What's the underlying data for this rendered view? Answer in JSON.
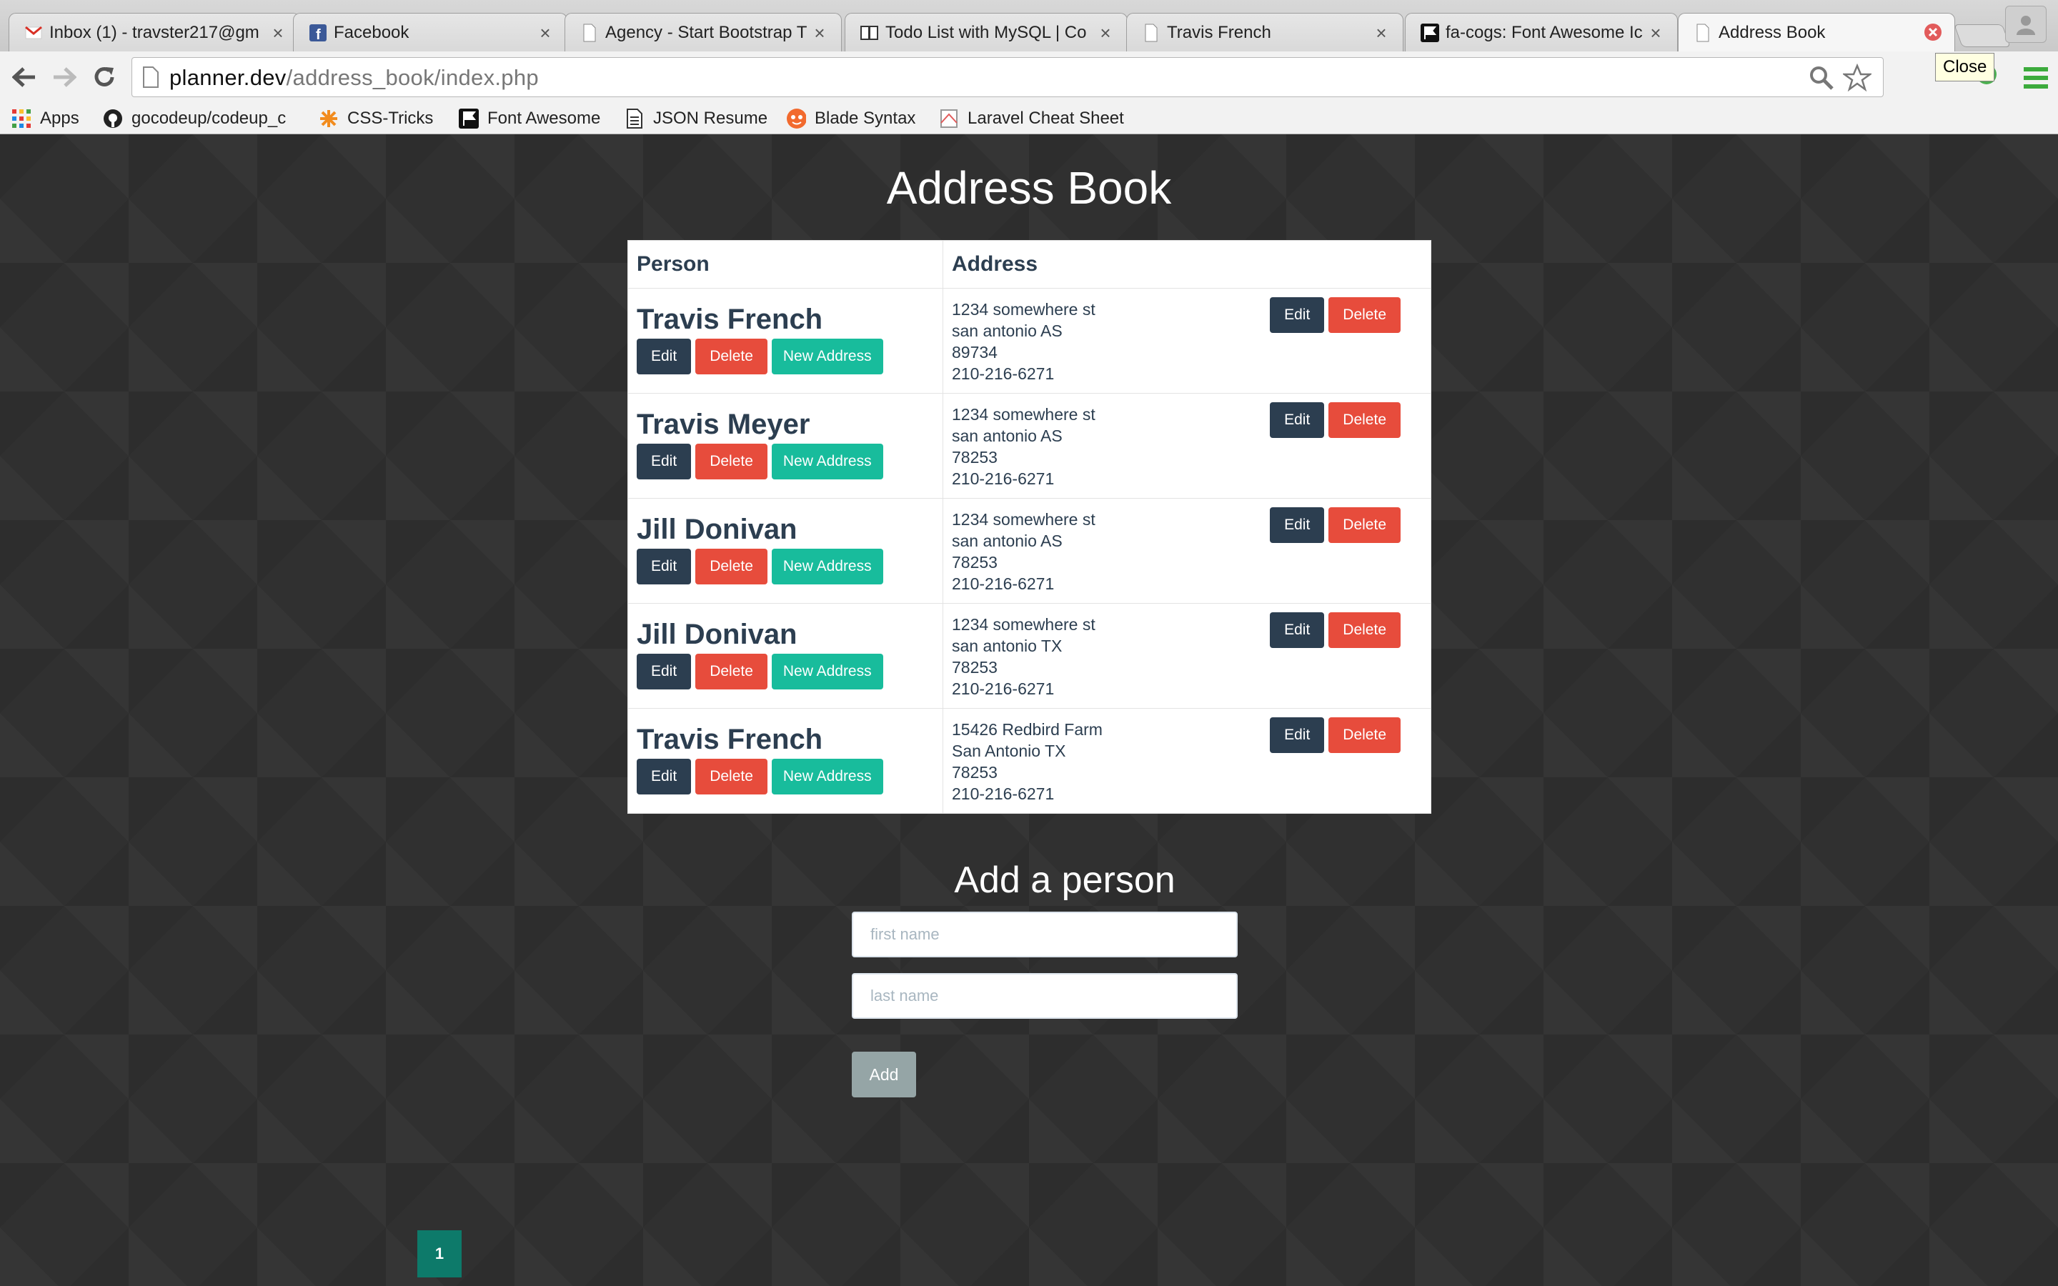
{
  "browser": {
    "tabs": [
      {
        "title": "Inbox (1) - travster217@gm",
        "icon": "gmail-icon"
      },
      {
        "title": "Facebook",
        "icon": "facebook-icon"
      },
      {
        "title": "Agency - Start Bootstrap T",
        "icon": "page-icon"
      },
      {
        "title": "Todo List with MySQL | Co",
        "icon": "book-icon"
      },
      {
        "title": "Travis French",
        "icon": "page-icon"
      },
      {
        "title": "fa-cogs: Font Awesome Ic",
        "icon": "flag-icon"
      },
      {
        "title": "Address Book",
        "icon": "page-icon"
      }
    ],
    "url_host": "planner.dev",
    "url_path": "/address_book/index.php",
    "tooltip": "Close",
    "bookmarks": [
      {
        "label": "Apps",
        "icon": "apps-grid-icon"
      },
      {
        "label": "gocodeup/codeup_c",
        "icon": "github-icon"
      },
      {
        "label": "CSS-Tricks",
        "icon": "css-tricks-icon"
      },
      {
        "label": "Font Awesome",
        "icon": "flag-icon"
      },
      {
        "label": "JSON Resume",
        "icon": "document-icon"
      },
      {
        "label": "Blade Syntax",
        "icon": "blade-icon"
      },
      {
        "label": "Laravel Cheat Sheet",
        "icon": "laravel-icon"
      }
    ]
  },
  "page": {
    "title": "Address Book",
    "table": {
      "headers": [
        "Person",
        "Address"
      ],
      "rows": [
        {
          "name": "Travis French",
          "address": [
            "1234 somewhere st",
            "san antonio AS",
            "89734",
            "210-216-6271"
          ]
        },
        {
          "name": "Travis Meyer",
          "address": [
            "1234 somewhere st",
            "san antonio AS",
            "78253",
            "210-216-6271"
          ]
        },
        {
          "name": "Jill Donivan",
          "address": [
            "1234 somewhere st",
            "san antonio AS",
            "78253",
            "210-216-6271"
          ]
        },
        {
          "name": "Jill Donivan",
          "address": [
            "1234 somewhere st",
            "san antonio TX",
            "78253",
            "210-216-6271"
          ]
        },
        {
          "name": "Travis French",
          "address": [
            "15426 Redbird Farm",
            "San Antonio TX",
            "78253",
            "210-216-6271"
          ]
        }
      ],
      "buttons": {
        "edit": "Edit",
        "delete": "Delete",
        "new_address": "New Address"
      }
    },
    "add_form": {
      "title": "Add a person",
      "first_name_placeholder": "first name",
      "last_name_placeholder": "last name",
      "submit_label": "Add"
    },
    "pagination": {
      "current": "1"
    }
  },
  "colors": {
    "primary": "#2c3e50",
    "danger": "#e74c3c",
    "success": "#18bc9c",
    "disabled": "#95a5a6",
    "page_bg": "#303030"
  }
}
